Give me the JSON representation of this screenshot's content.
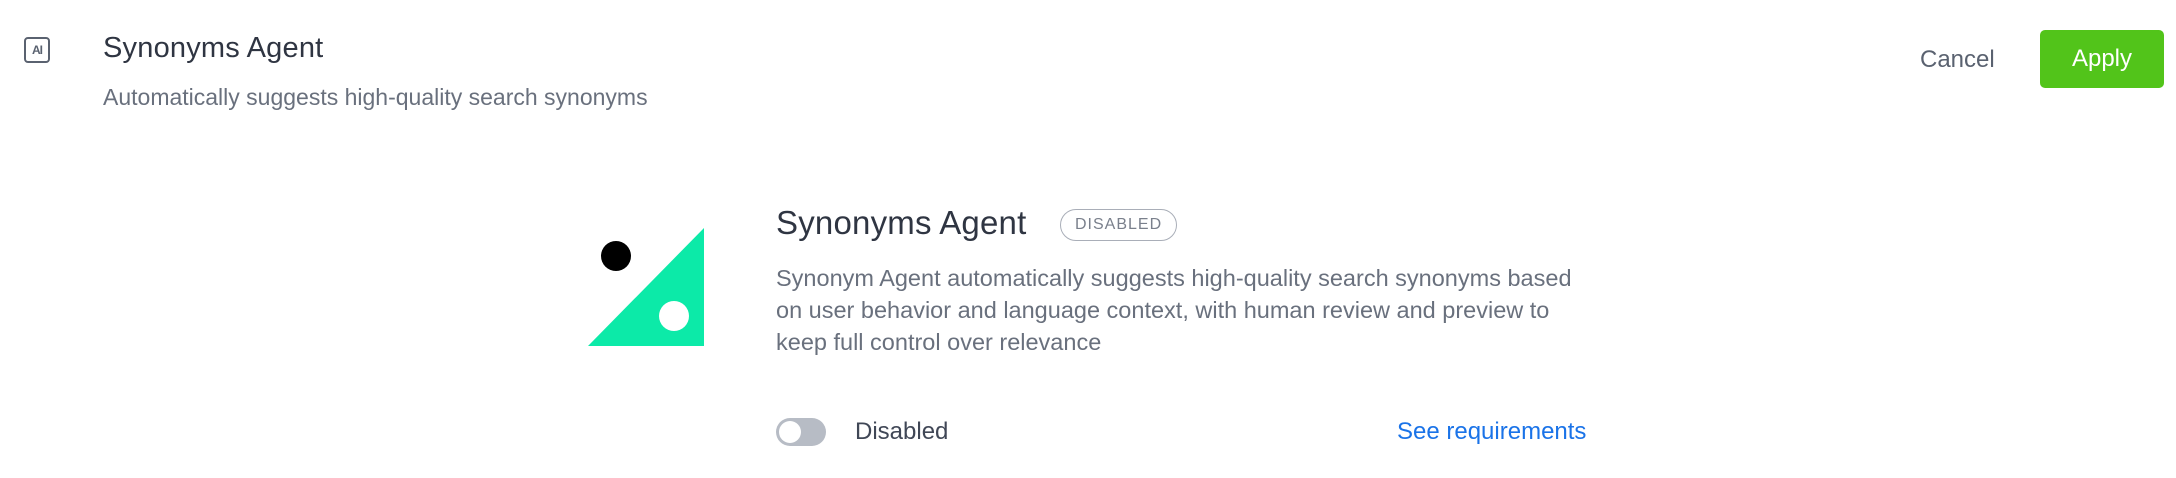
{
  "header": {
    "icon": "ai-agent-icon",
    "icon_text": "AI",
    "title": "Synonyms Agent",
    "subtitle": "Automatically suggests high-quality search synonyms",
    "cancel_label": "Cancel",
    "apply_label": "Apply"
  },
  "agent": {
    "logo": "synonyms-agent-logo",
    "title": "Synonyms Agent",
    "status_badge": "DISABLED",
    "description": "Synonym Agent automatically suggests high-quality search synonyms based on user behavior and language context, with human review and preview to keep full control over relevance",
    "toggle_state": "off",
    "toggle_label": "Disabled",
    "requirements_link": "See requirements"
  },
  "colors": {
    "apply_button": "#52c41a",
    "link": "#1a73e8",
    "logo_teal": "#0ceaa8",
    "toggle_off": "#b7bcc5"
  }
}
